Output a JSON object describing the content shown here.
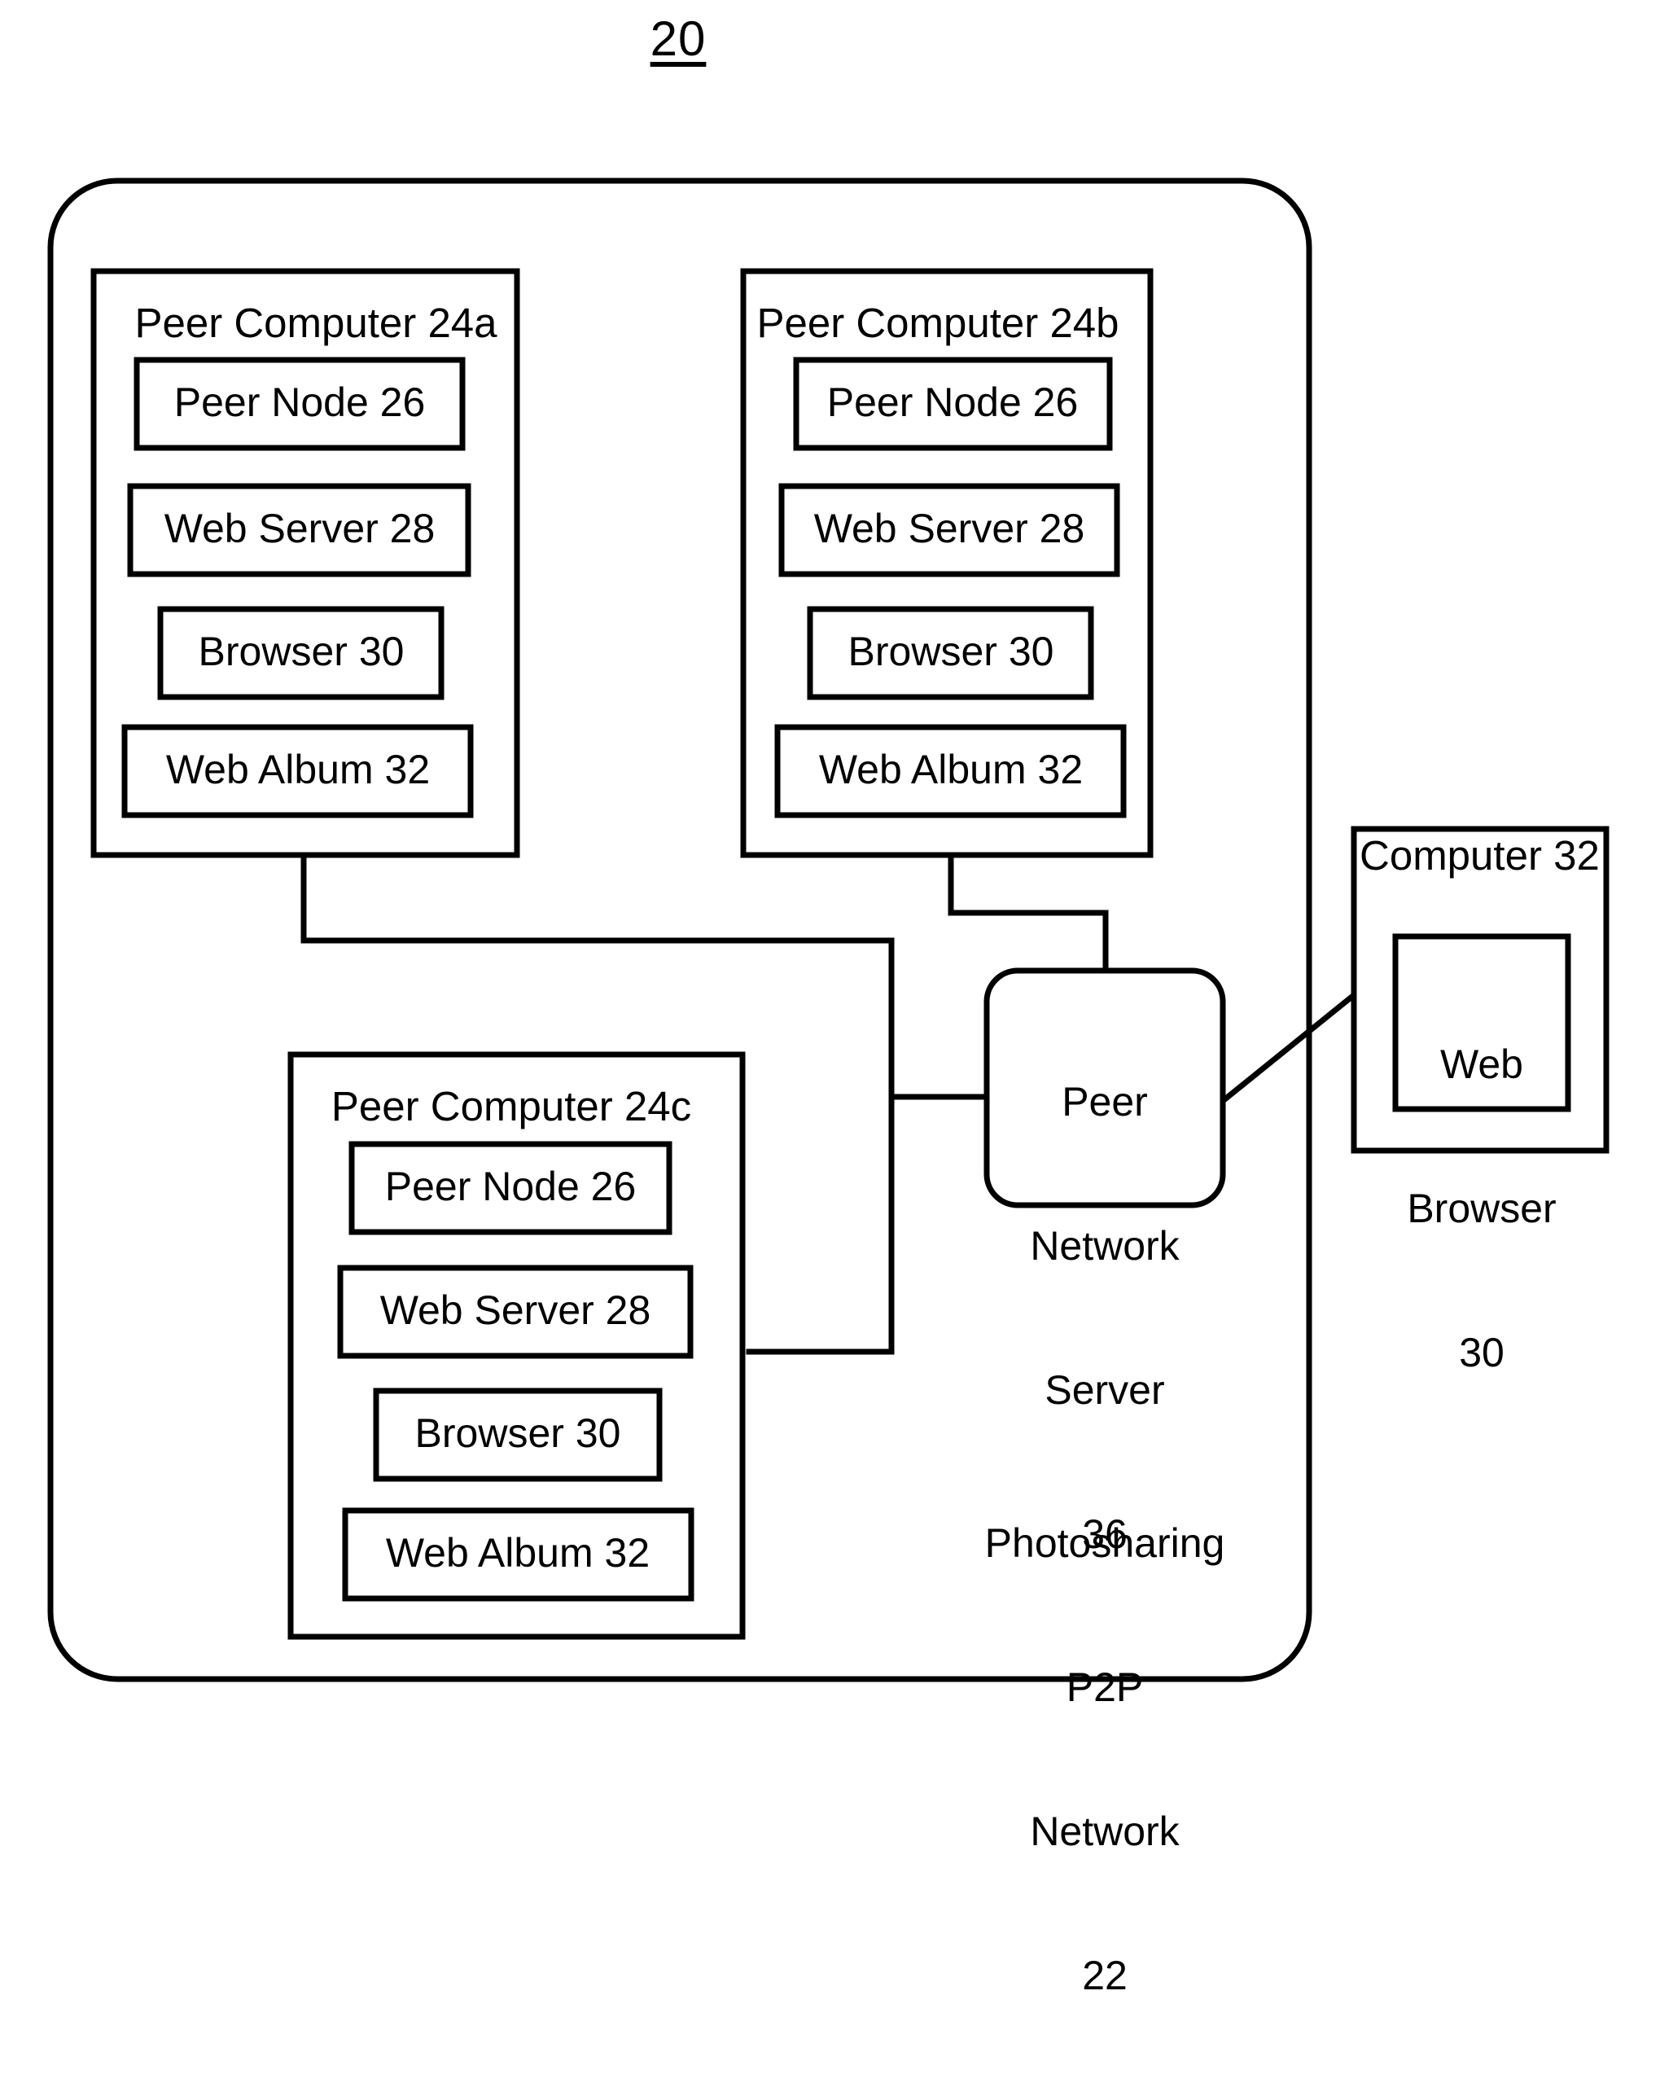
{
  "figure": {
    "number": "20",
    "type": "patent-block-diagram"
  },
  "network": {
    "label_lines": [
      "Photosharing",
      "P2P",
      "Network",
      "22"
    ],
    "label_full": "Photosharing P2P Network 22"
  },
  "peer_computers": [
    {
      "id": "24a",
      "title": "Peer Computer 24a",
      "components": [
        {
          "name": "peer-node",
          "label": "Peer Node 26"
        },
        {
          "name": "web-server",
          "label": "Web Server 28"
        },
        {
          "name": "browser",
          "label": "Browser 30"
        },
        {
          "name": "web-album",
          "label": "Web Album 32"
        }
      ]
    },
    {
      "id": "24b",
      "title": "Peer Computer 24b",
      "components": [
        {
          "name": "peer-node",
          "label": "Peer Node 26"
        },
        {
          "name": "web-server",
          "label": "Web Server 28"
        },
        {
          "name": "browser",
          "label": "Browser 30"
        },
        {
          "name": "web-album",
          "label": "Web Album 32"
        }
      ]
    },
    {
      "id": "24c",
      "title": "Peer Computer 24c",
      "components": [
        {
          "name": "peer-node",
          "label": "Peer Node 26"
        },
        {
          "name": "web-server",
          "label": "Web Server 28"
        },
        {
          "name": "browser",
          "label": "Browser 30"
        },
        {
          "name": "web-album",
          "label": "Web Album 32"
        }
      ]
    }
  ],
  "server": {
    "label_lines": [
      "Peer",
      "Network",
      "Server",
      "36"
    ],
    "label_full": "Peer Network Server 36"
  },
  "external_computer": {
    "title": "Computer 32",
    "browser_lines": [
      "Web",
      "Browser",
      "30"
    ],
    "browser_full": "Web Browser 30"
  },
  "style": {
    "line_color": "#000000",
    "background": "#ffffff"
  }
}
